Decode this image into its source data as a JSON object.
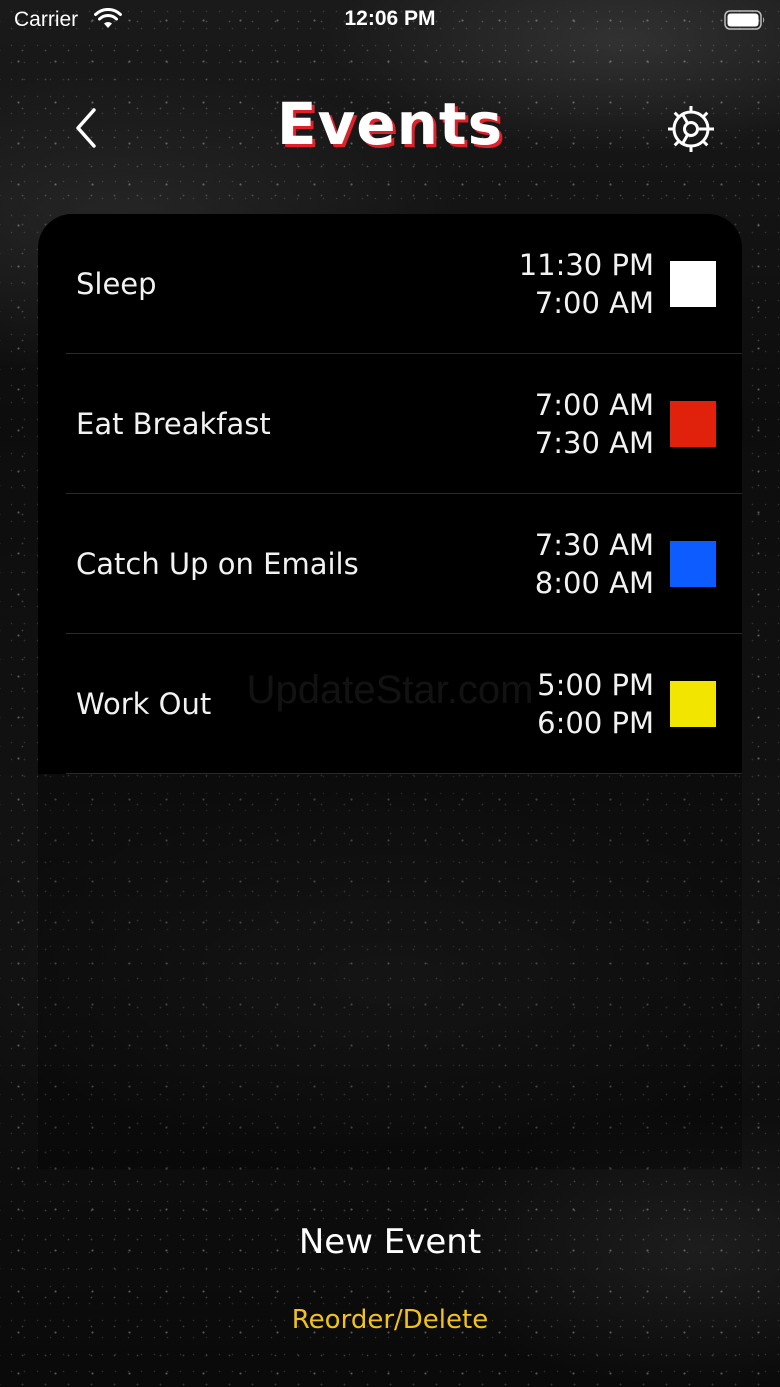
{
  "status_bar": {
    "carrier": "Carrier",
    "time": "12:06 PM"
  },
  "header": {
    "title": "Events",
    "title_color": "#ffffff",
    "title_shadow_color": "#e0202a",
    "back_icon": "chevron-left-icon",
    "settings_icon": "gear-icon"
  },
  "events": [
    {
      "name": "Sleep",
      "start": "11:30 PM",
      "end": "7:00 AM",
      "color": "#ffffff"
    },
    {
      "name": "Eat Breakfast",
      "start": "7:00 AM",
      "end": "7:30 AM",
      "color": "#e0220c"
    },
    {
      "name": "Catch Up on Emails",
      "start": "7:30 AM",
      "end": "8:00 AM",
      "color": "#0d5cff"
    },
    {
      "name": "Work Out",
      "start": "5:00 PM",
      "end": "6:00 PM",
      "color": "#f2e600"
    }
  ],
  "watermark": "UpdateStar.com",
  "actions": {
    "new_event": "New Event",
    "reorder_delete": "Reorder/Delete",
    "reorder_color": "#f2c21b"
  }
}
